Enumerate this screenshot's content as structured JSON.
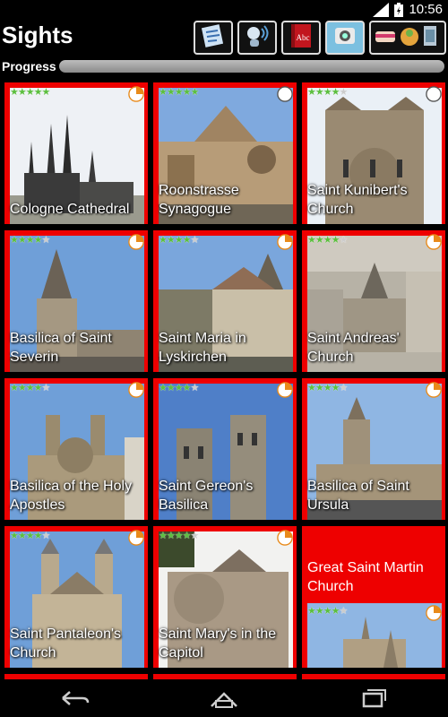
{
  "status": {
    "time": "10:56",
    "network": "3G"
  },
  "app": {
    "title": "Sights"
  },
  "toolbar": {
    "buttons": [
      {
        "name": "map-tool-button",
        "icon": "map-icon"
      },
      {
        "name": "audio-guide-button",
        "icon": "speaker-person-icon"
      },
      {
        "name": "dictionary-button",
        "icon": "book-abc-icon",
        "label": "Abc"
      },
      {
        "name": "sights-button",
        "icon": "camera-icon",
        "active": true
      },
      {
        "name": "food-drink-button",
        "icon": "food-icon"
      }
    ]
  },
  "progress": {
    "label": "Progress",
    "value": 0.0
  },
  "sights": [
    {
      "name": "Cologne Cathedral",
      "stars": 5,
      "progress": 0.25
    },
    {
      "name": "Roonstrasse Synagogue",
      "stars": 5,
      "progress": 0.0
    },
    {
      "name": "Saint Kunibert's Church",
      "stars": 4,
      "progress": 0.0
    },
    {
      "name": "Basilica of Saint Severin",
      "stars": 4,
      "progress": 0.25
    },
    {
      "name": "Saint Maria in Lyskirchen",
      "stars": 4,
      "progress": 0.25
    },
    {
      "name": "Saint Andreas' Church",
      "stars": 4,
      "progress": 0.25
    },
    {
      "name": "Basilica of the Holy Apostles",
      "stars": 4,
      "progress": 0.25
    },
    {
      "name": "Saint Gereon's Basilica",
      "stars": 4,
      "progress": 0.25
    },
    {
      "name": "Basilica of Saint Ursula",
      "stars": 4,
      "progress": 0.25
    },
    {
      "name": "Saint Pantaleon's Church",
      "stars": 4,
      "progress": 0.25
    },
    {
      "name": "Saint Mary's in the Capitol",
      "stars": 4,
      "progress": 0.25
    },
    {
      "name": "Great Saint Martin Church",
      "stars": 4,
      "progress": 0.25
    }
  ],
  "colors": {
    "card_border": "#ee0000",
    "progress_green": "#4a9b3a",
    "active_tool": "#7cc0e0",
    "sky": "#6f9fd8"
  },
  "nav": {
    "back": "back-icon",
    "home": "home-icon",
    "recents": "recents-icon"
  }
}
